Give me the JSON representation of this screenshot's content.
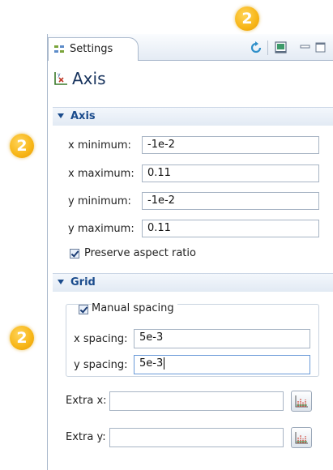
{
  "badges": {
    "top": "2",
    "mid": "2",
    "low": "2"
  },
  "tab": {
    "label": "Settings"
  },
  "title": "Axis",
  "axis_section": {
    "heading": "Axis",
    "x_min_label": "x minimum:",
    "x_min_value": "-1e-2",
    "x_max_label": "x maximum:",
    "x_max_value": "0.11",
    "y_min_label": "y minimum:",
    "y_min_value": "-1e-2",
    "y_max_label": "y maximum:",
    "y_max_value": "0.11",
    "preserve_label": "Preserve aspect ratio"
  },
  "grid_section": {
    "heading": "Grid",
    "manual_label": "Manual spacing",
    "x_spacing_label": "x spacing:",
    "x_spacing_value": "5e-3",
    "y_spacing_label": "y spacing:",
    "y_spacing_value": "5e-3",
    "extra_x_label": "Extra x:",
    "extra_x_value": "",
    "extra_y_label": "Extra y:",
    "extra_y_value": ""
  },
  "icons": {
    "tab": "settings-icon",
    "refresh": "refresh-icon",
    "view": "view-icon",
    "minimize": "minimize-icon",
    "maximize": "maximize-icon",
    "axis": "axis-icon",
    "range_picker": "range-picker-icon"
  },
  "colors": {
    "accent": "#1a4b8c",
    "badge": "#f7b516",
    "panel_border": "#a9b8cc"
  }
}
